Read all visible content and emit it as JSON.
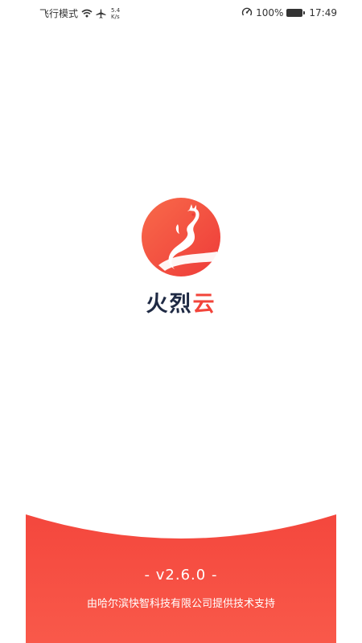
{
  "status_bar": {
    "mode_text": "飞行模式",
    "net_speed_value": "5.4",
    "net_speed_unit": "K/s",
    "battery_text": "100%",
    "clock": "17:49"
  },
  "splash": {
    "app_name_part1": "火烈",
    "app_name_part2": "云",
    "version": "- v2.6.0 -",
    "support_text": "由哈尔滨快智科技有限公司提供技术支持"
  },
  "colors": {
    "brand_red": "#f2443a",
    "brand_orange": "#f86a4a",
    "name_dark": "#1f2a44"
  },
  "icons": [
    "wifi-icon",
    "airplane-icon",
    "speedometer-icon",
    "battery-icon",
    "flamingo-dragon-logo"
  ]
}
